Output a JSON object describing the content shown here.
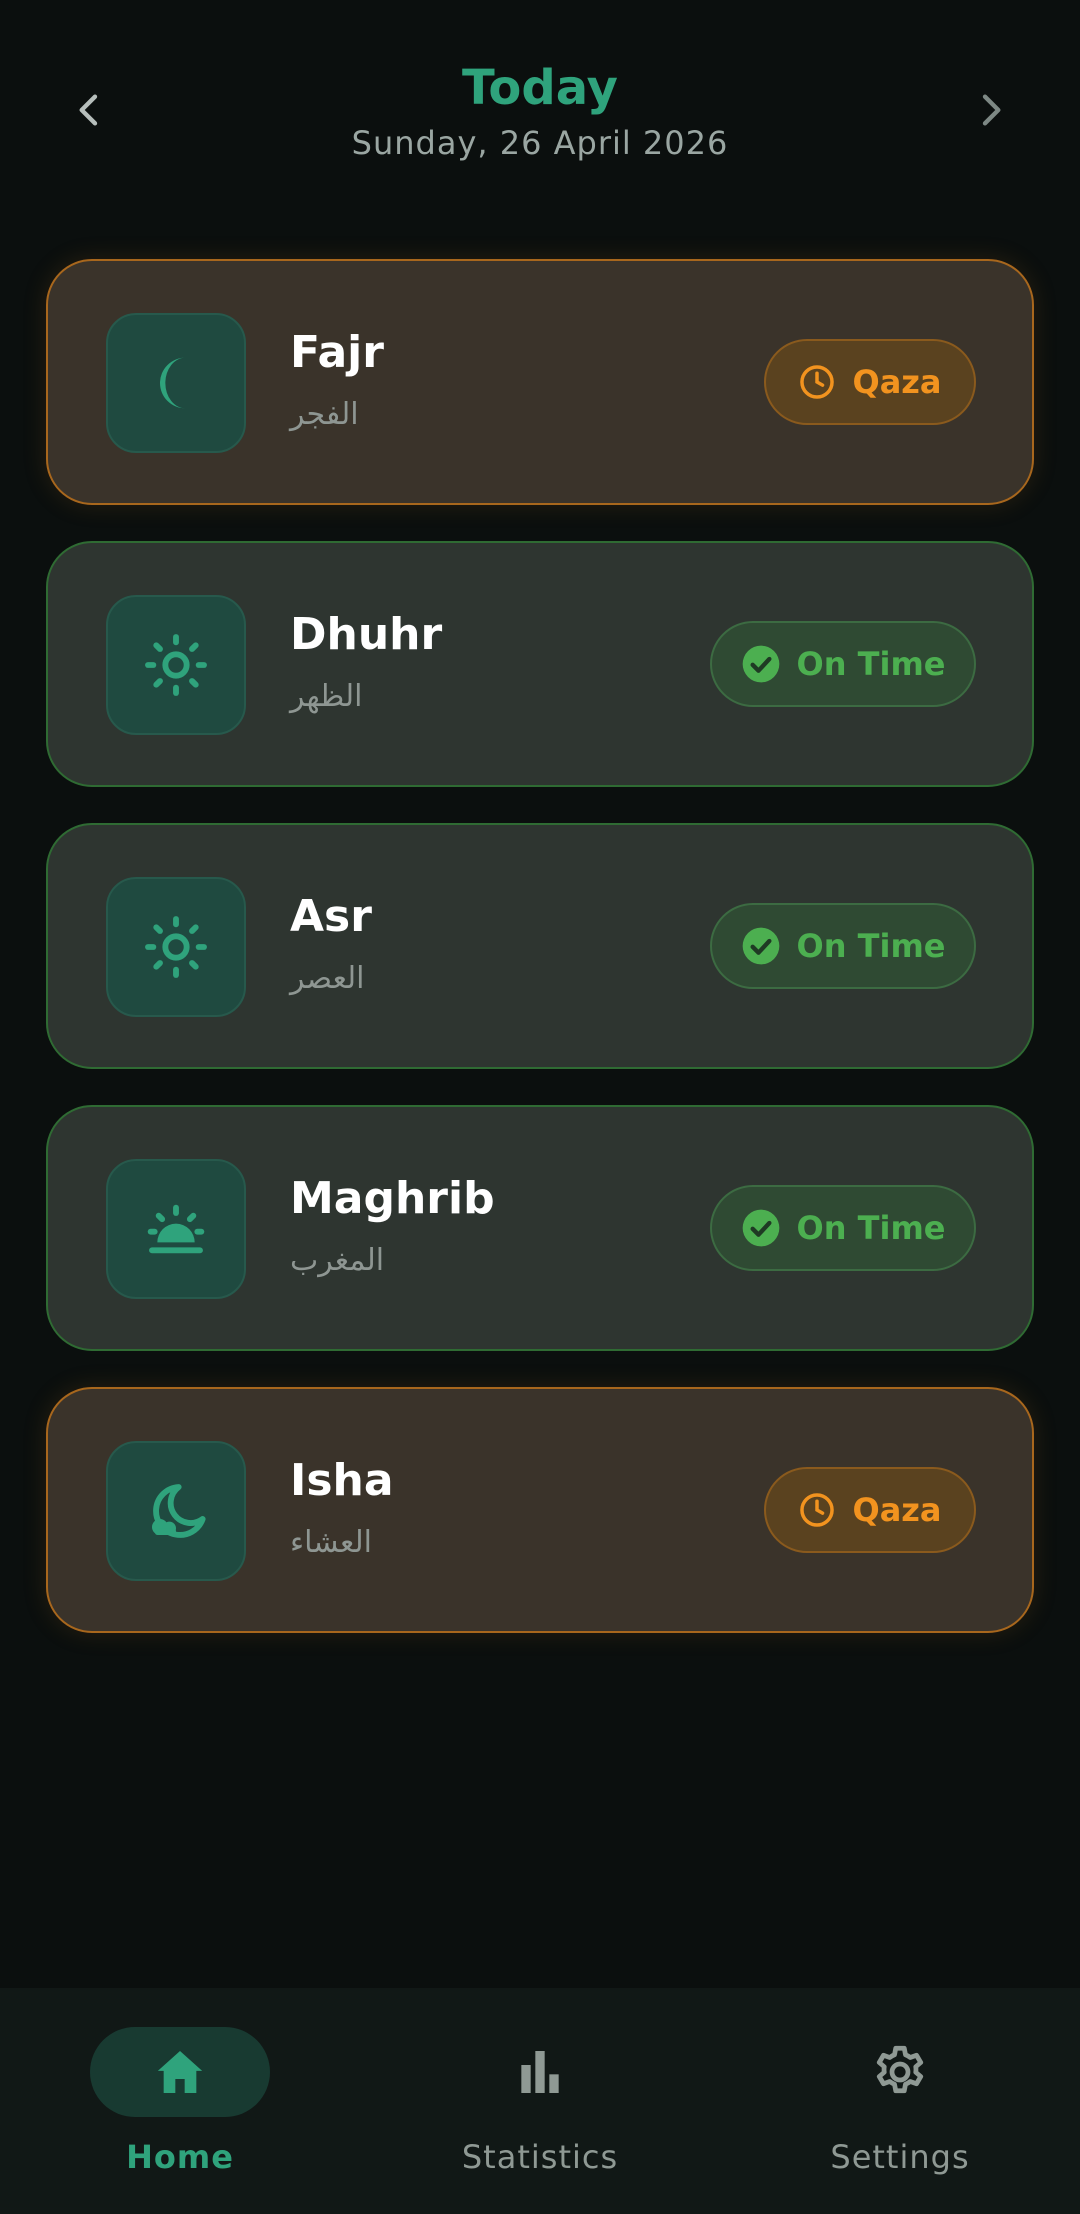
{
  "header": {
    "title": "Today",
    "date": "Sunday, 26 April 2026",
    "prev_icon": "chevron-left-icon",
    "next_icon": "chevron-right-icon"
  },
  "colors": {
    "accent": "#2fa37c",
    "qaza": "#f2931f",
    "on_time": "#4caf50",
    "background": "#0b0f0e"
  },
  "prayers": [
    {
      "name": "Fajr",
      "arabic": "الفجر",
      "icon": "moon-icon",
      "status": "Qaza",
      "status_icon": "clock-icon"
    },
    {
      "name": "Dhuhr",
      "arabic": "الظهر",
      "icon": "sun-icon",
      "status": "On Time",
      "status_icon": "check-circle-icon"
    },
    {
      "name": "Asr",
      "arabic": "العصر",
      "icon": "sun-icon",
      "status": "On Time",
      "status_icon": "check-circle-icon"
    },
    {
      "name": "Maghrib",
      "arabic": "المغرب",
      "icon": "sunset-icon",
      "status": "On Time",
      "status_icon": "check-circle-icon"
    },
    {
      "name": "Isha",
      "arabic": "العشاء",
      "icon": "moon-cloud-icon",
      "status": "Qaza",
      "status_icon": "clock-icon"
    }
  ],
  "bottom_nav": {
    "items": [
      {
        "label": "Home",
        "icon": "home-icon",
        "active": true
      },
      {
        "label": "Statistics",
        "icon": "bar-chart-icon",
        "active": false
      },
      {
        "label": "Settings",
        "icon": "gear-icon",
        "active": false
      }
    ]
  }
}
